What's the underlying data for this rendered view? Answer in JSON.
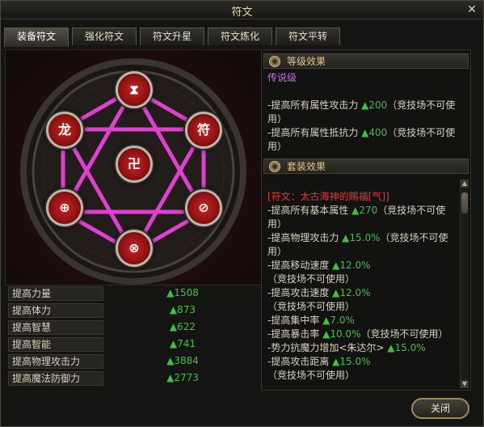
{
  "window": {
    "title": "符文"
  },
  "tabs": [
    {
      "label": "装备符文",
      "active": true
    },
    {
      "label": "强化符文",
      "active": false
    },
    {
      "label": "符文升星",
      "active": false
    },
    {
      "label": "符文炼化",
      "active": false
    },
    {
      "label": "符文平转",
      "active": false
    }
  ],
  "runes": [
    {
      "glyph": "⧗"
    },
    {
      "glyph": "龙"
    },
    {
      "glyph": "符"
    },
    {
      "glyph": "卍"
    },
    {
      "glyph": "⊕"
    },
    {
      "glyph": "⊘"
    },
    {
      "glyph": "⊗"
    }
  ],
  "stats": [
    {
      "label": "提高力量",
      "value": "▲1508"
    },
    {
      "label": "提高体力",
      "value": "▲873"
    },
    {
      "label": "提高智慧",
      "value": "▲622"
    },
    {
      "label": "提高智能",
      "value": "▲741"
    },
    {
      "label": "提高物理攻击力",
      "value": "▲3884"
    },
    {
      "label": "提高魔法防御力",
      "value": "▲2773"
    }
  ],
  "grade_section": {
    "title": "等级效果",
    "grade": "传说级",
    "lines": [
      {
        "text": "-提高所有属性攻击力 ",
        "value": "▲200",
        "suffix": "（竞技场不可使用）"
      },
      {
        "text": "-提高所有属性抵抗力 ",
        "value": "▲400",
        "suffix": "（竞技场不可使用）"
      }
    ]
  },
  "set_section": {
    "title": "套装效果",
    "set_name": "[符文：太古海神的赐福[气]]",
    "lines": [
      {
        "text": "-提高所有基本属性 ",
        "value": "▲270",
        "suffix": "（竞技场不可使用）"
      },
      {
        "text": "-提高物理攻击力 ",
        "value": "▲15.0%",
        "suffix": "（竞技场不可使用）"
      },
      {
        "text": "-提高移动速度 ",
        "value": "▲12.0%",
        "suffix": "（竞技场不可使用）"
      },
      {
        "text": "-提高攻击速度 ",
        "value": "▲12.0%",
        "suffix": "（竞技场不可使用）"
      },
      {
        "text": "-提高集中率 ",
        "value": "▲7.0%",
        "suffix": ""
      },
      {
        "text": "-提高暴击率 ",
        "value": "▲10.0%",
        "suffix": "（竞技场不可使用）"
      },
      {
        "text": "-势力抗魔力增加<朱达尔> ",
        "value": "▲15.0%",
        "suffix": ""
      },
      {
        "text": "-提高攻击距离 ",
        "value": "▲15.0%",
        "suffix": "（竞技场不可使用）"
      }
    ]
  },
  "footer": {
    "close_label": "关闭"
  },
  "colors": {
    "accent_gold": "#e3c98c",
    "magenta_lines": "#e040d0",
    "rune_red": "#c62626",
    "positive_green": "#3fc23f",
    "legendary_purple": "#c86ee8",
    "set_red": "#e23a3a"
  }
}
